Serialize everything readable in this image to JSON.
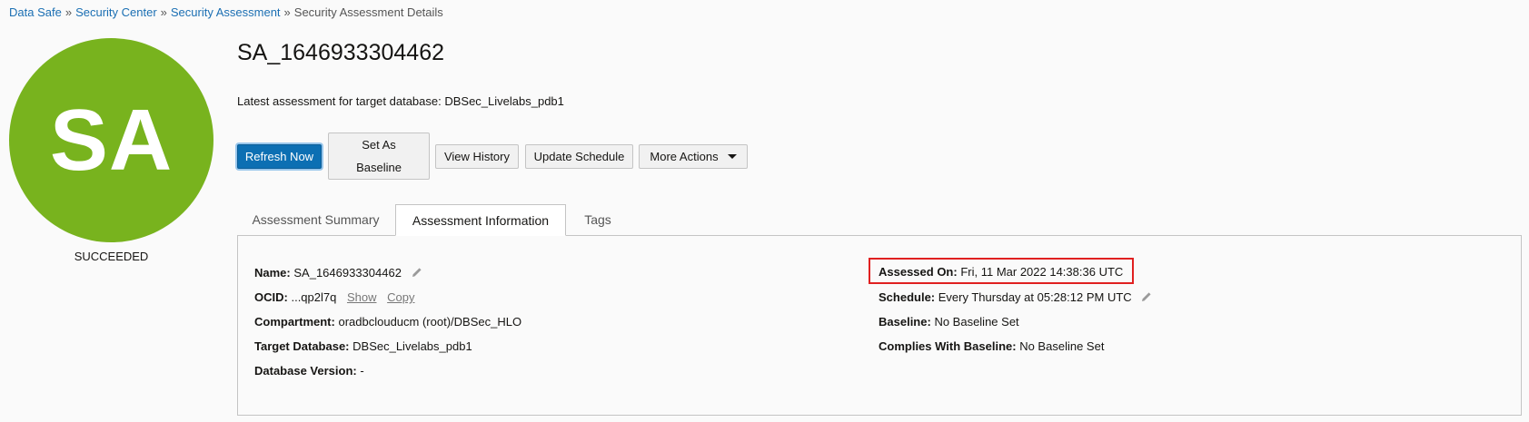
{
  "breadcrumb": {
    "items": [
      "Data Safe",
      "Security Center",
      "Security Assessment"
    ],
    "separator": "»",
    "current": "Security Assessment Details"
  },
  "avatar": {
    "initials": "SA",
    "color": "#78b31e",
    "status": "SUCCEEDED"
  },
  "header": {
    "title": "SA_1646933304462",
    "subtitle": "Latest assessment for target database: DBSec_Livelabs_pdb1"
  },
  "actions": {
    "refresh": "Refresh Now",
    "baseline_line1": "Set As",
    "baseline_line2": "Baseline",
    "history": "View History",
    "schedule": "Update Schedule",
    "more": "More Actions"
  },
  "tabs": [
    {
      "label": "Assessment Summary",
      "active": false
    },
    {
      "label": "Assessment Information",
      "active": true
    },
    {
      "label": "Tags",
      "active": false
    }
  ],
  "info": {
    "name_label": "Name:",
    "name_value": "SA_1646933304462",
    "ocid_label": "OCID:",
    "ocid_value": "...qp2l7q",
    "ocid_show": "Show",
    "ocid_copy": "Copy",
    "compartment_label": "Compartment:",
    "compartment_value": "oradbclouducm (root)/DBSec_HLO",
    "target_label": "Target Database:",
    "target_value": "DBSec_Livelabs_pdb1",
    "version_label": "Database Version:",
    "version_value": "-",
    "assessed_label": "Assessed On:",
    "assessed_value": "Fri, 11 Mar 2022 14:38:36 UTC",
    "schedule_label": "Schedule:",
    "schedule_value": "Every Thursday at 05:28:12 PM UTC",
    "baseline_label": "Baseline:",
    "baseline_value": "No Baseline Set",
    "complies_label": "Complies With Baseline:",
    "complies_value": "No Baseline Set"
  },
  "colors": {
    "link": "#1b6fb3",
    "primary": "#0c6fb3",
    "highlight": "#e02020"
  }
}
